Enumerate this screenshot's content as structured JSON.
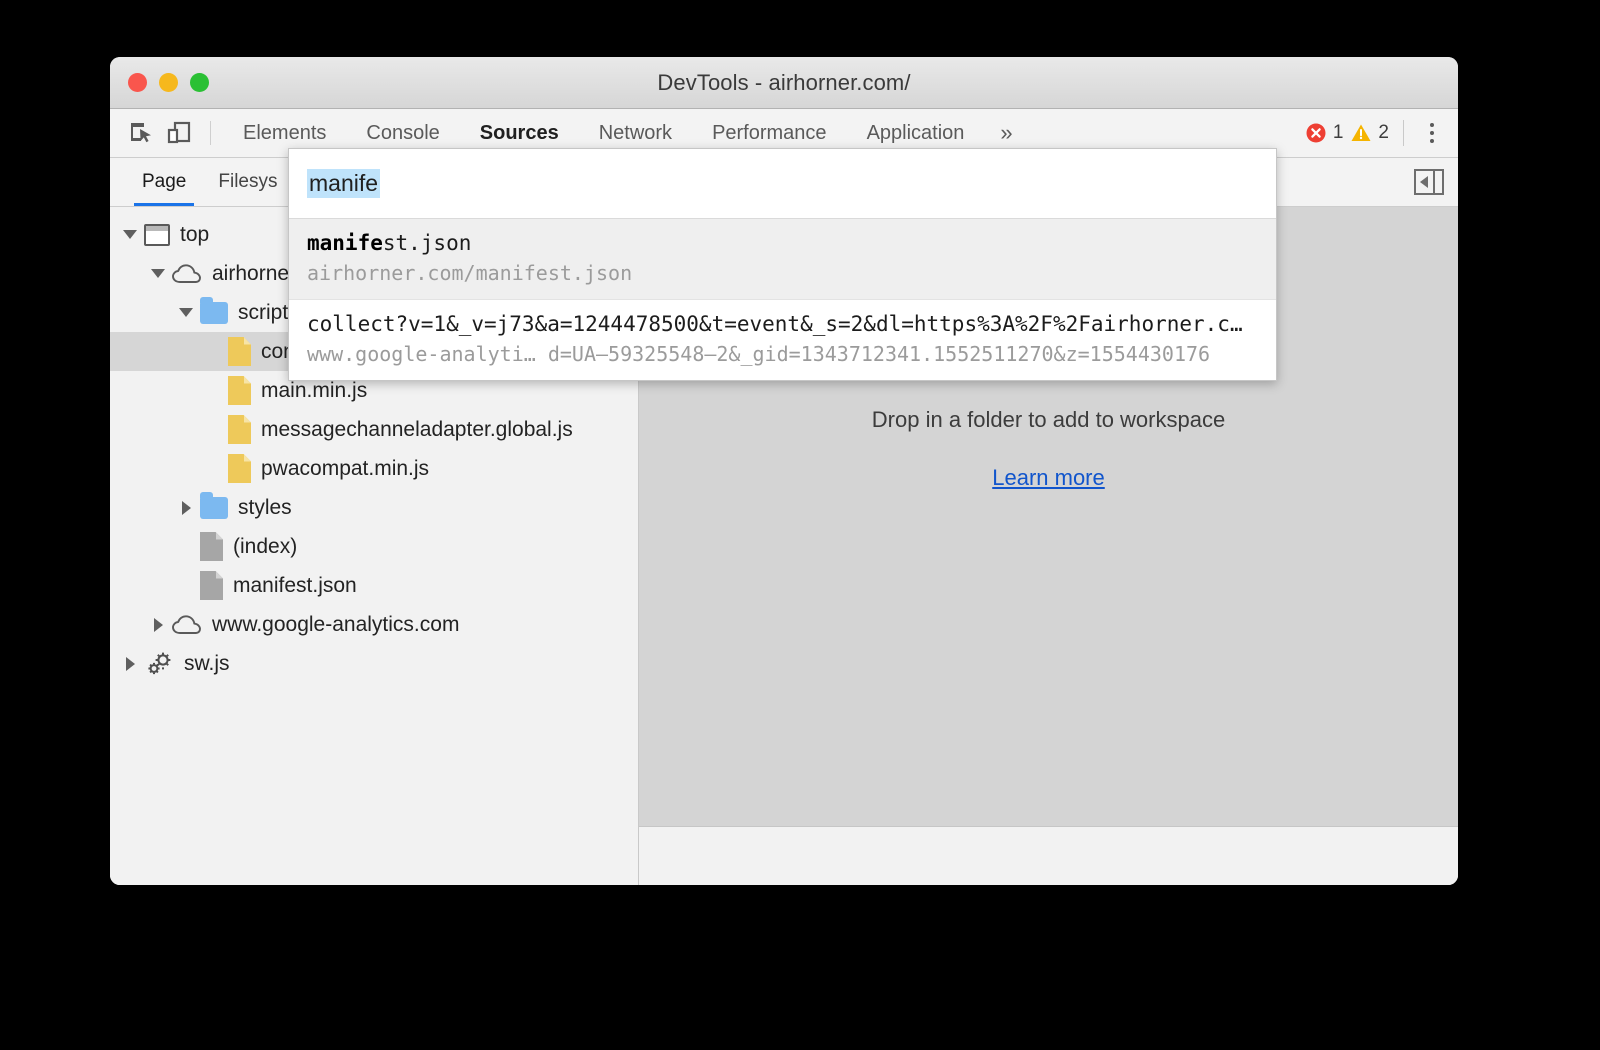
{
  "window": {
    "title": "DevTools - airhorner.com/",
    "traffic_lights": [
      "close",
      "minimize",
      "zoom"
    ]
  },
  "toolbar": {
    "inspect_icon": "inspect-element-icon",
    "device_icon": "device-toolbar-icon",
    "panels": [
      {
        "label": "Elements",
        "active": false
      },
      {
        "label": "Console",
        "active": false
      },
      {
        "label": "Sources",
        "active": true
      },
      {
        "label": "Network",
        "active": false
      },
      {
        "label": "Performance",
        "active": false
      },
      {
        "label": "Application",
        "active": false
      }
    ],
    "more_panels_label": "»",
    "errors": {
      "icon": "error-icon",
      "count": "1",
      "color": "#ee3f33"
    },
    "warnings": {
      "icon": "warning-icon",
      "count": "2",
      "color": "#f5b400"
    },
    "menu_icon": "kebab-menu-icon"
  },
  "sub_toolbar": {
    "tabs": [
      {
        "label": "Page",
        "active": true
      },
      {
        "label": "Filesys",
        "active": false
      }
    ],
    "collapse_label": "collapse-sidebar-icon"
  },
  "navigator": {
    "tree": [
      {
        "label": "top",
        "depth": 0,
        "icon": "frame",
        "twisty": "down"
      },
      {
        "label": "airhorne",
        "depth": 1,
        "icon": "cloud",
        "twisty": "down"
      },
      {
        "label": "scripts",
        "depth": 2,
        "icon": "folder",
        "twisty": "down"
      },
      {
        "label": "conn.min.global.js",
        "depth": 3,
        "icon": "file-js",
        "twisty": "none",
        "selected": true
      },
      {
        "label": "main.min.js",
        "depth": 3,
        "icon": "file-js",
        "twisty": "none"
      },
      {
        "label": "messagechanneladapter.global.js",
        "depth": 3,
        "icon": "file-js",
        "twisty": "none"
      },
      {
        "label": "pwacompat.min.js",
        "depth": 3,
        "icon": "file-js",
        "twisty": "none"
      },
      {
        "label": "styles",
        "depth": 2,
        "icon": "folder",
        "twisty": "right"
      },
      {
        "label": "(index)",
        "depth": 2,
        "icon": "file-doc",
        "twisty": "none"
      },
      {
        "label": "manifest.json",
        "depth": 2,
        "icon": "file-doc",
        "twisty": "none"
      },
      {
        "label": "www.google-analytics.com",
        "depth": 1,
        "icon": "cloud",
        "twisty": "right"
      },
      {
        "label": "sw.js",
        "depth": 0,
        "icon": "gear",
        "twisty": "right"
      }
    ]
  },
  "editor": {
    "drop_text": "Drop in a folder to add to workspace",
    "learn_more": "Learn more",
    "link_color": "#1155cc"
  },
  "quick_open": {
    "query": "manife",
    "items": [
      {
        "title_match": "manife",
        "title_rest": "st.json",
        "subtitle": "airhorner.com/manifest.json",
        "selected": true
      },
      {
        "title_match": "",
        "title_rest": "collect?v=1&_v=j73&a=1244478500&t=event&_s=2&dl=https%3A%2F%2Fairhorner.c…",
        "subtitle": "www.google-analyti… d=UA–59325548–2&_gid=1343712341.1552511270&z=1554430176",
        "selected": false
      }
    ]
  }
}
